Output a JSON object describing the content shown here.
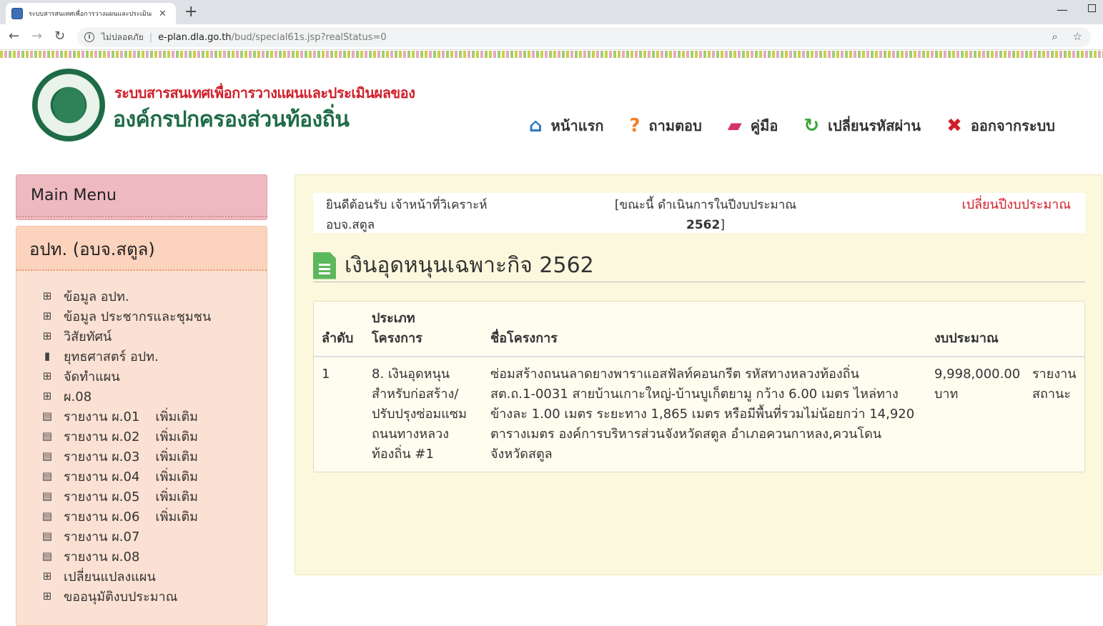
{
  "browser": {
    "tab_title": "ระบบสารสนเทศเพื่อการวางแผนและประเมินผลของ",
    "insecure_label": "ไม่ปลอดภัย",
    "url_host": "e-plan.dla.go.th",
    "url_path": "/bud/special61s.jsp?realStatus=0"
  },
  "header": {
    "title_line1": "ระบบสารสนเทศเพื่อการวางแผนและประเมินผลของ",
    "title_line2": "องค์กรปกครองส่วนท้องถิ่น",
    "nav": [
      {
        "label": "หน้าแรก",
        "icon": "home-icon",
        "color": "#2e7bc4"
      },
      {
        "label": "ถามตอบ",
        "icon": "question-icon",
        "color": "#f0802a"
      },
      {
        "label": "คู่มือ",
        "icon": "book-icon",
        "color": "#d6326b"
      },
      {
        "label": "เปลี่ยนรหัสผ่าน",
        "icon": "refresh-icon",
        "color": "#3aa63a"
      },
      {
        "label": "ออกจากระบบ",
        "icon": "close-icon",
        "color": "#d11f2a"
      }
    ]
  },
  "sidebar": {
    "main_menu": "Main Menu",
    "section_title": "อปท. (อบจ.สตูล)",
    "items": [
      {
        "label": "ข้อมูล อปท.",
        "icon": "sitemap-icon",
        "extra": ""
      },
      {
        "label": "ข้อมูล ประชากรและชุมชน",
        "icon": "sitemap-icon",
        "extra": ""
      },
      {
        "label": "วิสัยทัศน์",
        "icon": "sitemap-icon",
        "extra": ""
      },
      {
        "label": "ยุทธศาสตร์ อปท.",
        "icon": "bookmark-icon",
        "extra": ""
      },
      {
        "label": "จัดทำแผน",
        "icon": "sitemap-icon",
        "extra": ""
      },
      {
        "label": "ผ.08",
        "icon": "sitemap-icon",
        "extra": ""
      },
      {
        "label": "รายงาน ผ.01",
        "icon": "file-icon",
        "extra": "เพิ่มเติม"
      },
      {
        "label": "รายงาน ผ.02",
        "icon": "file-icon",
        "extra": "เพิ่มเติม"
      },
      {
        "label": "รายงาน ผ.03",
        "icon": "file-icon",
        "extra": "เพิ่มเติม"
      },
      {
        "label": "รายงาน ผ.04",
        "icon": "file-icon",
        "extra": "เพิ่มเติม"
      },
      {
        "label": "รายงาน ผ.05",
        "icon": "file-icon",
        "extra": "เพิ่มเติม"
      },
      {
        "label": "รายงาน ผ.06",
        "icon": "file-icon",
        "extra": "เพิ่มเติม"
      },
      {
        "label": "รายงาน ผ.07",
        "icon": "file-icon",
        "extra": ""
      },
      {
        "label": "รายงาน ผ.08",
        "icon": "file-icon",
        "extra": ""
      },
      {
        "label": "เปลี่ยนแปลงแผน",
        "icon": "sitemap-icon",
        "extra": ""
      },
      {
        "label": "ขออนุมัติงบประมาณ",
        "icon": "sitemap-icon",
        "extra": ""
      }
    ]
  },
  "main": {
    "welcome_line1": "ยินดีต้อนรับ เจ้าหน้าที่วิเคราะห์",
    "welcome_line2": "อบจ.สตูล",
    "status_line1": "[ขณะนี้ ดำเนินการในปีงบประมาณ",
    "status_year": "2562",
    "status_close": "]",
    "change_year": "เปลี่ยนปีงบประมาณ",
    "page_title": "เงินอุดหนุนเฉพาะกิจ 2562",
    "table": {
      "headers": {
        "no": "ลำดับ",
        "type_line1": "ประเภท",
        "type_line2": "โครงการ",
        "name": "ชื่อโครงการ",
        "budget": "งบประมาณ"
      },
      "rows": [
        {
          "no": "1",
          "type": [
            "8. เงินอุดหนุน",
            "สำหรับก่อสร้าง/",
            "ปรับปรุงซ่อมแซม",
            "ถนนทางหลวง",
            "ท้องถิ่น #1"
          ],
          "name": [
            "ซ่อมสร้างถนนลาดยางพาราแอสฟัลท์คอนกรีต รหัสทางหลวงท้องถิ่น",
            "สต.ถ.1-0031 สายบ้านเกาะใหญ่-บ้านบูเก็ตยามู กว้าง 6.00 เมตร ไหล่ทาง",
            "ข้างละ 1.00 เมตร ระยะทาง 1,865 เมตร หรือมีพื้นที่รวมไม่น้อยกว่า 14,920",
            "ตารางเมตร องค์การบริหารส่วนจังหวัดสตูล อำเภอควนกาหลง,ควนโดน",
            "จังหวัดสตูล"
          ],
          "budget": "9,998,000.00",
          "unit": "บาท",
          "action_line1": "รายงาน",
          "action_line2": "สถานะ"
        }
      ]
    }
  }
}
